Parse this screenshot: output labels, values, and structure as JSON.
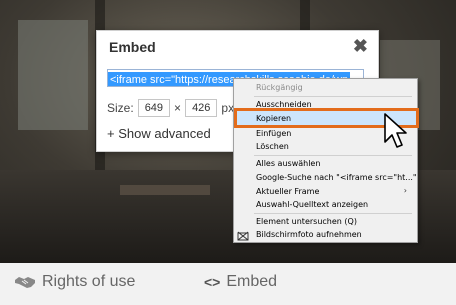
{
  "dialog": {
    "title": "Embed",
    "close_glyph": "✖",
    "code_text": "<iframe src=\"https://researchskills.scoobie.de/wp",
    "size_label": "Size:",
    "width_value": "649",
    "times_glyph": "×",
    "height_value": "426",
    "unit": "px",
    "show_advanced": "+ Show advanced"
  },
  "context_menu": {
    "items": [
      {
        "label": "Rückgängig",
        "disabled": true
      },
      {
        "label": "Ausschneiden"
      },
      {
        "label": "Kopieren",
        "highlighted": true
      },
      {
        "label": "Einfügen"
      },
      {
        "label": "Löschen"
      },
      {
        "label": "Alles auswählen"
      },
      {
        "label": "Google-Suche nach \"<iframe src=\"ht...\""
      },
      {
        "label": "Aktueller Frame",
        "has_submenu": true
      },
      {
        "label": "Auswahl-Quelltext anzeigen"
      },
      {
        "label": "Element untersuchen (Q)"
      },
      {
        "label": "Bildschirmfoto aufnehmen",
        "icon": "screenshot-icon"
      }
    ],
    "submenu_glyph": "›"
  },
  "footer": {
    "rights_label": "Rights of use",
    "embed_label": "Embed",
    "embed_glyph": "<>"
  },
  "colors": {
    "highlight_border": "#e36c1b",
    "selection_blue": "#3399ff",
    "footer_bg": "#f2f2f2"
  }
}
